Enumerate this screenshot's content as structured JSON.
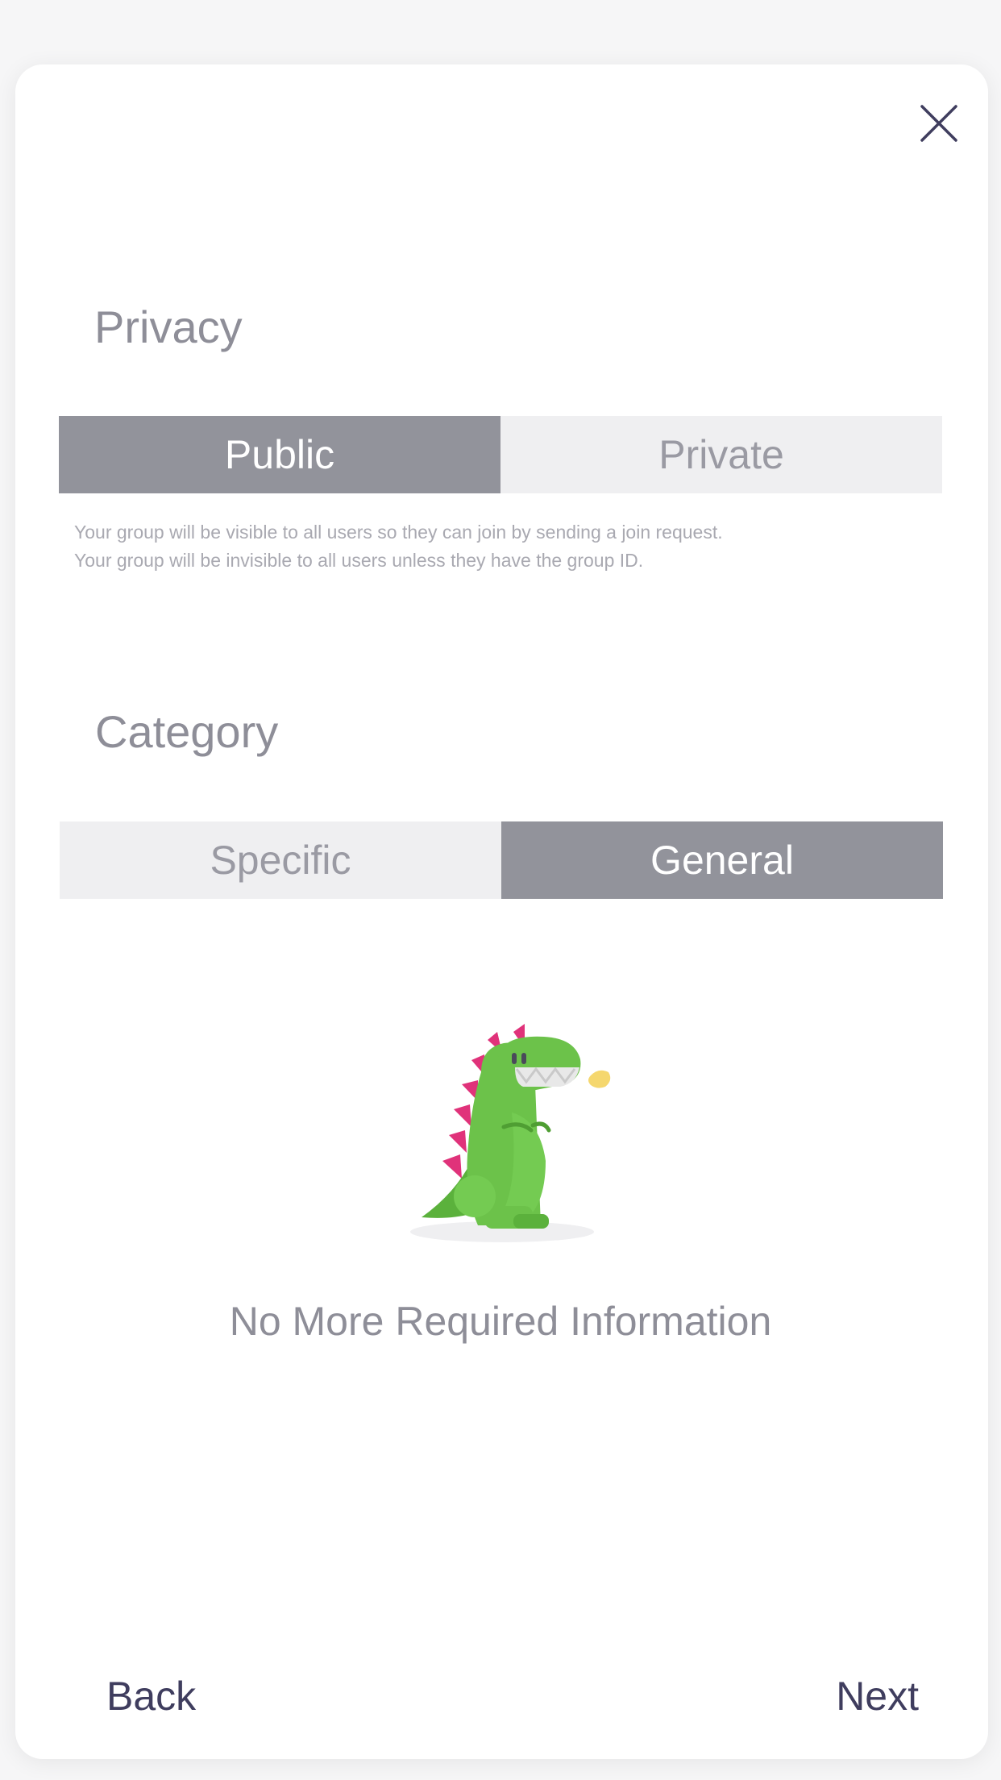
{
  "privacy": {
    "title": "Privacy",
    "options": [
      "Public",
      "Private"
    ],
    "selected": "Public",
    "descriptions": [
      "Your group will be visible to all users so they can join by sending a join request.",
      "Your group will be invisible to all users unless they have the group ID."
    ]
  },
  "category": {
    "title": "Category",
    "options": [
      "Specific",
      "General"
    ],
    "selected": "General"
  },
  "empty_state": {
    "illustration": "dinosaur-illustration",
    "message": "No More Required Information"
  },
  "footer": {
    "back_label": "Back",
    "next_label": "Next"
  },
  "icons": {
    "close": "close-icon"
  },
  "colors": {
    "active_segment": "#92939b",
    "inactive_segment": "#efeff1",
    "title_text": "#8e8e98",
    "footer_text": "#3f3d5e",
    "dino_green": "#6cc24a",
    "dino_spikes": "#e0327a"
  }
}
